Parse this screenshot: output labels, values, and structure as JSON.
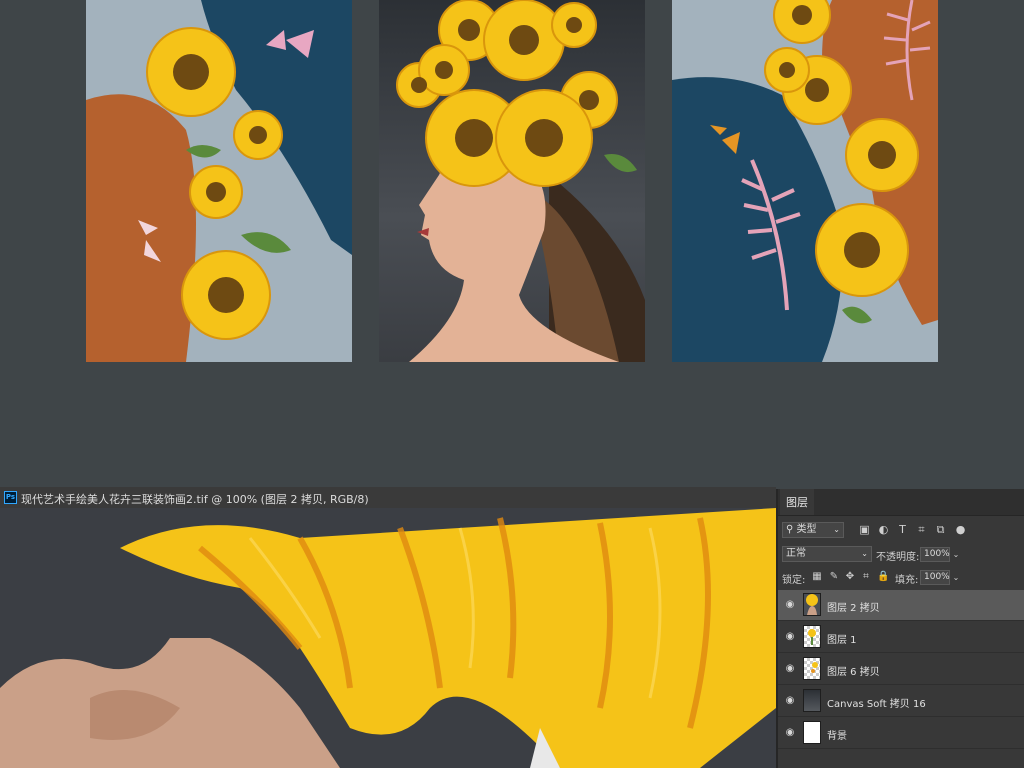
{
  "document": {
    "title": "现代艺术手绘美人花卉三联装饰画2.tif @ 100% (图层 2 拷贝, RGB/8)",
    "app_icon": "Ps"
  },
  "layers_panel": {
    "tab_label": "图层",
    "filter_label": "类型",
    "blend_mode": "正常",
    "opacity_label": "不透明度:",
    "opacity_value": "100%",
    "lock_label": "锁定:",
    "fill_label": "填充:",
    "fill_value": "100%",
    "layers": [
      {
        "name": "图层 2 拷贝",
        "selected": true,
        "visible": true
      },
      {
        "name": "图层 1",
        "selected": false,
        "visible": true
      },
      {
        "name": "图层 6 拷贝",
        "selected": false,
        "visible": true
      },
      {
        "name": "Canvas Soft 拷贝 16",
        "selected": false,
        "visible": true
      },
      {
        "name": "背景",
        "selected": false,
        "visible": true
      }
    ]
  },
  "colors": {
    "workspace_bg": "#3f4548",
    "panel_bg": "#383838",
    "selected_layer": "#5a5a5a",
    "sunflower_yellow": "#f5c318",
    "navy": "#1c4763",
    "terracotta": "#b5612e",
    "slate_blue": "#a3b2bd"
  }
}
